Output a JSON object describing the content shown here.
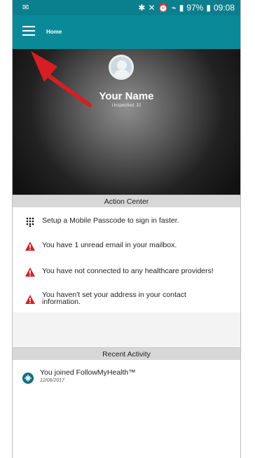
{
  "status_bar": {
    "battery": "97%",
    "time": "09:08"
  },
  "header": {
    "title": "Home"
  },
  "profile": {
    "name": "Your Name",
    "subtitle": "Unspecified, 32"
  },
  "action_center": {
    "title": "Action Center",
    "items": [
      {
        "text": "Setup a Mobile Passcode to sign in faster.",
        "icon": "keypad-icon"
      },
      {
        "text": "You have 1 unread email in your mailbox.",
        "icon": "warning-icon"
      },
      {
        "text": "You have not connected to any healthcare providers!",
        "icon": "warning-icon"
      },
      {
        "text": "You haven't set your address in your contact information.",
        "icon": "warning-icon"
      }
    ]
  },
  "recent_activity": {
    "title": "Recent Activity",
    "items": [
      {
        "title": "You joined FollowMyHealth™",
        "date": "12/06/2017",
        "icon": "followmyhealth-icon"
      }
    ]
  },
  "colors": {
    "teal": "#0a8a98",
    "warning_red": "#d0232a"
  }
}
